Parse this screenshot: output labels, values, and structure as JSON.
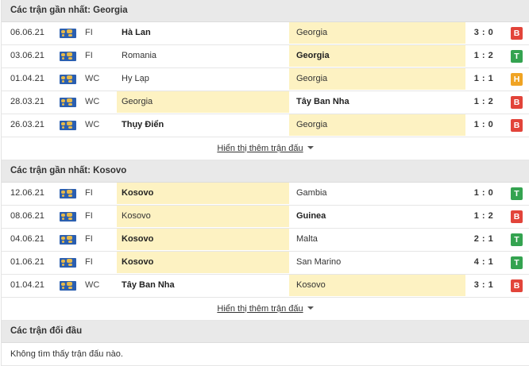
{
  "sections": [
    {
      "title": "Các trận gần nhất: Georgia",
      "matches": [
        {
          "date": "06.06.21",
          "comp": "FI",
          "home": "Hà Lan",
          "away": "Georgia",
          "score": "3 : 0",
          "result": "B",
          "home_bold": true,
          "away_bold": false,
          "hl": "away"
        },
        {
          "date": "03.06.21",
          "comp": "FI",
          "home": "Romania",
          "away": "Georgia",
          "score": "1 : 2",
          "result": "T",
          "home_bold": false,
          "away_bold": true,
          "hl": "away"
        },
        {
          "date": "01.04.21",
          "comp": "WC",
          "home": "Hy Lạp",
          "away": "Georgia",
          "score": "1 : 1",
          "result": "H",
          "home_bold": false,
          "away_bold": false,
          "hl": "away"
        },
        {
          "date": "28.03.21",
          "comp": "WC",
          "home": "Georgia",
          "away": "Tây Ban Nha",
          "score": "1 : 2",
          "result": "B",
          "home_bold": false,
          "away_bold": true,
          "hl": "home"
        },
        {
          "date": "26.03.21",
          "comp": "WC",
          "home": "Thụy Điển",
          "away": "Georgia",
          "score": "1 : 0",
          "result": "B",
          "home_bold": true,
          "away_bold": false,
          "hl": "away"
        }
      ],
      "more_label": "Hiển thị thêm trận đấu"
    },
    {
      "title": "Các trận gần nhất: Kosovo",
      "matches": [
        {
          "date": "12.06.21",
          "comp": "FI",
          "home": "Kosovo",
          "away": "Gambia",
          "score": "1 : 0",
          "result": "T",
          "home_bold": true,
          "away_bold": false,
          "hl": "home"
        },
        {
          "date": "08.06.21",
          "comp": "FI",
          "home": "Kosovo",
          "away": "Guinea",
          "score": "1 : 2",
          "result": "B",
          "home_bold": false,
          "away_bold": true,
          "hl": "home"
        },
        {
          "date": "04.06.21",
          "comp": "FI",
          "home": "Kosovo",
          "away": "Malta",
          "score": "2 : 1",
          "result": "T",
          "home_bold": true,
          "away_bold": false,
          "hl": "home"
        },
        {
          "date": "01.06.21",
          "comp": "FI",
          "home": "Kosovo",
          "away": "San Marino",
          "score": "4 : 1",
          "result": "T",
          "home_bold": true,
          "away_bold": false,
          "hl": "home"
        },
        {
          "date": "01.04.21",
          "comp": "WC",
          "home": "Tây Ban Nha",
          "away": "Kosovo",
          "score": "3 : 1",
          "result": "B",
          "home_bold": true,
          "away_bold": false,
          "hl": "away"
        }
      ],
      "more_label": "Hiển thị thêm trận đấu"
    }
  ],
  "h2h": {
    "title": "Các trận đối đầu",
    "empty_text": "Không tìm thấy trận đấu nào."
  },
  "colors": {
    "B": "#e2443a",
    "T": "#34a350",
    "H": "#f0a424",
    "highlight": "#fdf2c2"
  },
  "icons": {
    "competition": "world-flag-icon",
    "more": "caret-down-icon"
  }
}
